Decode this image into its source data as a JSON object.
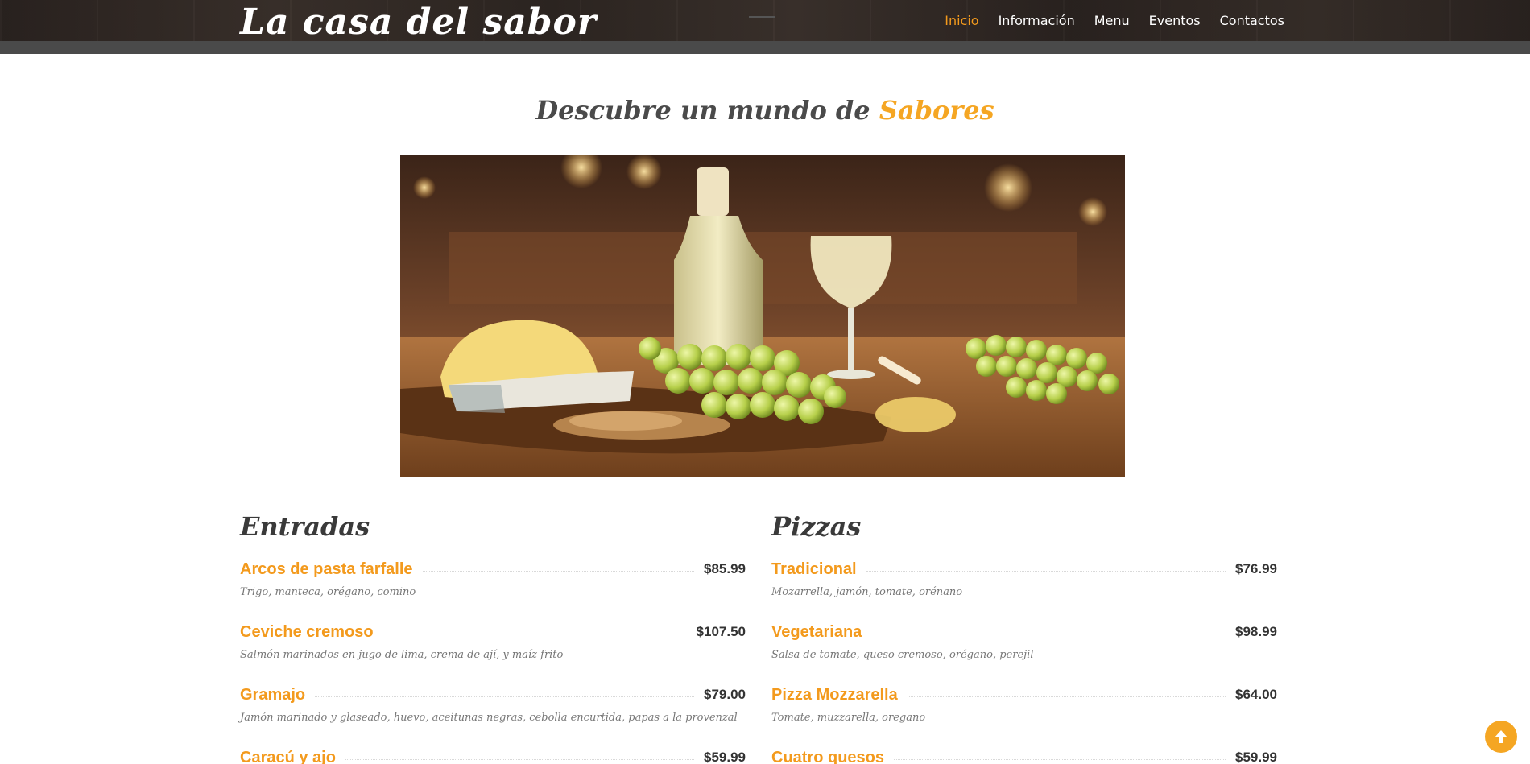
{
  "header": {
    "logo": "La casa del sabor",
    "nav": [
      {
        "label": "Inicio",
        "active": true
      },
      {
        "label": "Información",
        "active": false
      },
      {
        "label": "Menu",
        "active": false
      },
      {
        "label": "Eventos",
        "active": false
      },
      {
        "label": "Contactos",
        "active": false
      }
    ]
  },
  "hero": {
    "title_prefix": "Descubre un mundo de",
    "title_accent": "Sabores",
    "image_icon": "wine-cheese-grapes-photo"
  },
  "menus": {
    "left": {
      "heading": "Entradas",
      "items": [
        {
          "name": "Arcos de pasta farfalle",
          "price": "$85.99",
          "desc": "Trigo, manteca, orégano, comino"
        },
        {
          "name": "Ceviche cremoso",
          "price": "$107.50",
          "desc": "Salmón marinados en jugo de lima, crema de ají, y maíz frito"
        },
        {
          "name": "Gramajo",
          "price": "$79.00",
          "desc": "Jamón marinado y glaseado, huevo, aceitunas negras, cebolla encurtida, papas a la provenzal"
        },
        {
          "name": "Caracú y ajo",
          "price": "$59.99",
          "desc": ""
        }
      ]
    },
    "right": {
      "heading": "Pizzas",
      "items": [
        {
          "name": "Tradicional",
          "price": "$76.99",
          "desc": "Mozarrella, jamón, tomate, orénano"
        },
        {
          "name": "Vegetariana",
          "price": "$98.99",
          "desc": "Salsa de tomate, queso cremoso, orégano, perejil"
        },
        {
          "name": "Pizza Mozzarella",
          "price": "$64.00",
          "desc": "Tomate, muzzarella, oregano"
        },
        {
          "name": "Cuatro quesos",
          "price": "$59.99",
          "desc": ""
        }
      ]
    }
  },
  "colors": {
    "accent": "#f39a1d",
    "header_bg": "#2a2320",
    "text_dark": "#333333"
  },
  "scroll_top_icon": "arrow-up-icon"
}
